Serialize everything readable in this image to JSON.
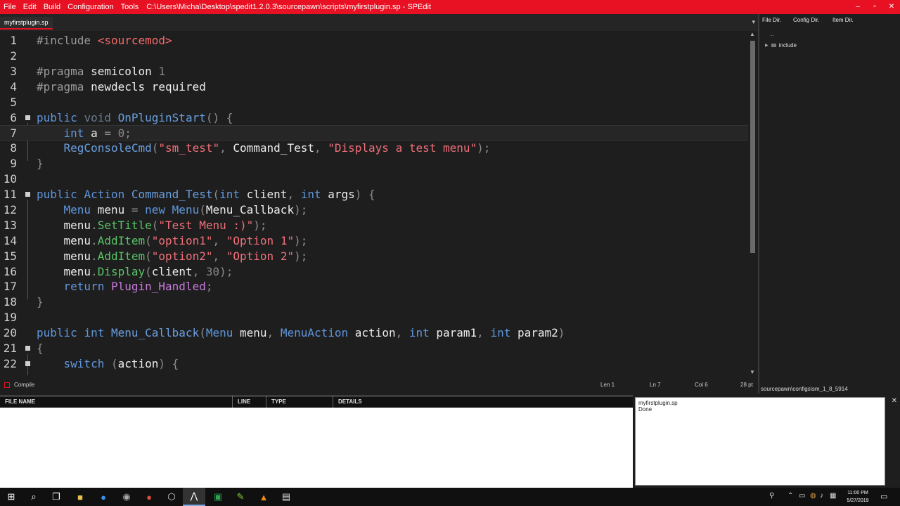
{
  "menu": [
    "File",
    "Edit",
    "Build",
    "Configuration",
    "Tools"
  ],
  "title": "C:\\Users\\Micha\\Desktop\\spedit1.2.0.3\\sourcepawn\\scripts\\myfirstplugin.sp - SPEdit",
  "window_controls": {
    "minimize": "–",
    "maximize": "▫",
    "close": "✕"
  },
  "tab": {
    "label": "myfirstplugin.sp",
    "dropdown": "▾"
  },
  "code_lines": [
    {
      "n": "1",
      "t": [
        [
          "pp",
          "#include "
        ],
        [
          "inc",
          "<sourcemod>"
        ]
      ]
    },
    {
      "n": "2",
      "t": []
    },
    {
      "n": "3",
      "t": [
        [
          "pp",
          "#pragma "
        ],
        [
          "plain",
          "semicolon "
        ],
        [
          "num",
          "1"
        ]
      ]
    },
    {
      "n": "4",
      "t": [
        [
          "pp",
          "#pragma "
        ],
        [
          "plain",
          "newdecls required"
        ]
      ]
    },
    {
      "n": "5",
      "t": []
    },
    {
      "n": "6",
      "fold": true,
      "t": [
        [
          "kw",
          "public "
        ],
        [
          "void",
          "void "
        ],
        [
          "fn",
          "OnPluginStart"
        ],
        [
          "punc",
          "() {"
        ]
      ]
    },
    {
      "n": "7",
      "current": true,
      "t": [
        [
          "plain",
          "    "
        ],
        [
          "kw",
          "int "
        ],
        [
          "plain",
          "a "
        ],
        [
          "punc",
          "= "
        ],
        [
          "num",
          "0"
        ],
        [
          "punc",
          ";"
        ]
      ]
    },
    {
      "n": "8",
      "t": [
        [
          "plain",
          "    "
        ],
        [
          "fn",
          "RegConsoleCmd"
        ],
        [
          "punc",
          "("
        ],
        [
          "str",
          "\"sm_test\""
        ],
        [
          "punc",
          ", "
        ],
        [
          "plain",
          "Command_Test"
        ],
        [
          "punc",
          ", "
        ],
        [
          "str",
          "\"Displays a test menu\""
        ],
        [
          "punc",
          ");"
        ]
      ]
    },
    {
      "n": "9",
      "t": [
        [
          "punc",
          "}"
        ]
      ]
    },
    {
      "n": "10",
      "t": []
    },
    {
      "n": "11",
      "fold": true,
      "t": [
        [
          "kw",
          "public "
        ],
        [
          "kw",
          "Action "
        ],
        [
          "fn",
          "Command_Test"
        ],
        [
          "punc",
          "("
        ],
        [
          "kw",
          "int "
        ],
        [
          "plain",
          "client"
        ],
        [
          "punc",
          ", "
        ],
        [
          "kw",
          "int "
        ],
        [
          "plain",
          "args"
        ],
        [
          "punc",
          ") {"
        ]
      ]
    },
    {
      "n": "12",
      "t": [
        [
          "plain",
          "    "
        ],
        [
          "kw",
          "Menu "
        ],
        [
          "plain",
          "menu "
        ],
        [
          "punc",
          "= "
        ],
        [
          "kw",
          "new "
        ],
        [
          "kw",
          "Menu"
        ],
        [
          "punc",
          "("
        ],
        [
          "plain",
          "Menu_Callback"
        ],
        [
          "punc",
          ");"
        ]
      ]
    },
    {
      "n": "13",
      "t": [
        [
          "plain",
          "    menu"
        ],
        [
          "punc",
          "."
        ],
        [
          "mth",
          "SetTitle"
        ],
        [
          "punc",
          "("
        ],
        [
          "str",
          "\"Test Menu :)\""
        ],
        [
          "punc",
          ");"
        ]
      ]
    },
    {
      "n": "14",
      "t": [
        [
          "plain",
          "    menu"
        ],
        [
          "punc",
          "."
        ],
        [
          "mth",
          "AddItem"
        ],
        [
          "punc",
          "("
        ],
        [
          "str",
          "\"option1\""
        ],
        [
          "punc",
          ", "
        ],
        [
          "str",
          "\"Option 1\""
        ],
        [
          "punc",
          ");"
        ]
      ]
    },
    {
      "n": "15",
      "t": [
        [
          "plain",
          "    menu"
        ],
        [
          "punc",
          "."
        ],
        [
          "mth",
          "AddItem"
        ],
        [
          "punc",
          "("
        ],
        [
          "str",
          "\"option2\""
        ],
        [
          "punc",
          ", "
        ],
        [
          "str",
          "\"Option 2\""
        ],
        [
          "punc",
          ");"
        ]
      ]
    },
    {
      "n": "16",
      "t": [
        [
          "plain",
          "    menu"
        ],
        [
          "punc",
          "."
        ],
        [
          "mth",
          "Display"
        ],
        [
          "punc",
          "("
        ],
        [
          "plain",
          "client"
        ],
        [
          "punc",
          ", "
        ],
        [
          "num",
          "30"
        ],
        [
          "punc",
          ");"
        ]
      ]
    },
    {
      "n": "17",
      "t": [
        [
          "plain",
          "    "
        ],
        [
          "kw",
          "return "
        ],
        [
          "cst",
          "Plugin_Handled"
        ],
        [
          "punc",
          ";"
        ]
      ]
    },
    {
      "n": "18",
      "t": [
        [
          "punc",
          "}"
        ]
      ]
    },
    {
      "n": "19",
      "t": []
    },
    {
      "n": "20",
      "t": [
        [
          "kw",
          "public "
        ],
        [
          "kw",
          "int "
        ],
        [
          "fn",
          "Menu_Callback"
        ],
        [
          "punc",
          "("
        ],
        [
          "kw",
          "Menu "
        ],
        [
          "plain",
          "menu"
        ],
        [
          "punc",
          ", "
        ],
        [
          "kw",
          "MenuAction "
        ],
        [
          "plain",
          "action"
        ],
        [
          "punc",
          ", "
        ],
        [
          "kw",
          "int "
        ],
        [
          "plain",
          "param1"
        ],
        [
          "punc",
          ", "
        ],
        [
          "kw",
          "int "
        ],
        [
          "plain",
          "param2"
        ],
        [
          "punc",
          ")"
        ]
      ]
    },
    {
      "n": "21",
      "fold": true,
      "t": [
        [
          "punc",
          "{"
        ]
      ]
    },
    {
      "n": "22",
      "fold": true,
      "t": [
        [
          "plain",
          "    "
        ],
        [
          "kw",
          "switch "
        ],
        [
          "punc",
          "("
        ],
        [
          "plain",
          "action"
        ],
        [
          "punc",
          ") {"
        ]
      ]
    }
  ],
  "status": {
    "compile": "Compile",
    "line": "Len 1",
    "ln": "Ln 7",
    "col": "Col 6",
    "pt": "28 pt"
  },
  "side": {
    "tabs": [
      "File Dir.",
      "Config Dir.",
      "Item Dir."
    ],
    "parent": "..",
    "tree": [
      "include"
    ],
    "path": "sourcepawn\\configs\\sm_1_8_5914"
  },
  "errors": {
    "columns": [
      "FILE NAME",
      "LINE",
      "TYPE",
      "DETAILS"
    ]
  },
  "output": {
    "lines": [
      "myfirstplugin.sp",
      "Done"
    ],
    "close": "✕"
  },
  "clock": {
    "time": "11:00 PM",
    "date": "5/27/2019"
  }
}
